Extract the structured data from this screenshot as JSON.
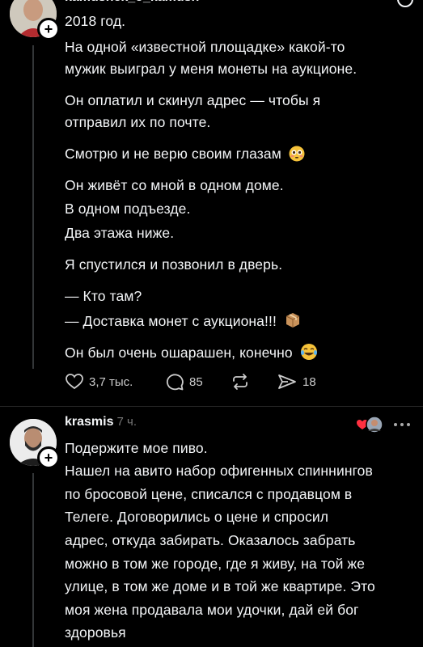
{
  "post1": {
    "username": "kamushek_o_kamush",
    "lines": [
      "2018 год.",
      "На одной «известной площадке» какой-то",
      "мужик выиграл у меня монеты на аукционе.",
      "Он оплатил и скинул адрес — чтобы я",
      "отправил их по почте.",
      "Смотрю и не верю своим глазам",
      "Он живёт со мной в одном доме.",
      "В одном подъезде.",
      "Два этажа ниже.",
      "Я спустился и позвонил в дверь.",
      "— Кто там?",
      "— Доставка монет с аукциона!!!",
      "Он был очень ошарашен, конечно"
    ],
    "actions": {
      "likes": "3,7 тыс.",
      "comments": "85",
      "reposts": "",
      "shares": "18"
    },
    "icons": [
      "heart-icon",
      "comment-icon",
      "repost-icon",
      "share-icon",
      "more-icon"
    ]
  },
  "post2": {
    "username": "krasmis",
    "time": "7 ч.",
    "lines": [
      "Подержите мое пиво.",
      "Нашел на авито набор офигенных спиннингов",
      "по бросовой цене, списался с продавцом в",
      "Телеге. Договорились о цене и спросил",
      "адрес, откуда забирать. Оказалось забрать",
      "можно в том же городе, где я живу, на той же",
      "улице, в том же доме и в той же квартире. Это",
      "моя жена продавала мои удочки, дай ей бог",
      "здоровья"
    ],
    "icons": [
      "liked-by-icon",
      "more-icon"
    ]
  },
  "colors": {
    "background": "#000000",
    "text": "#f3f5f7",
    "secondary": "#777777",
    "heart": "#ff3040"
  }
}
